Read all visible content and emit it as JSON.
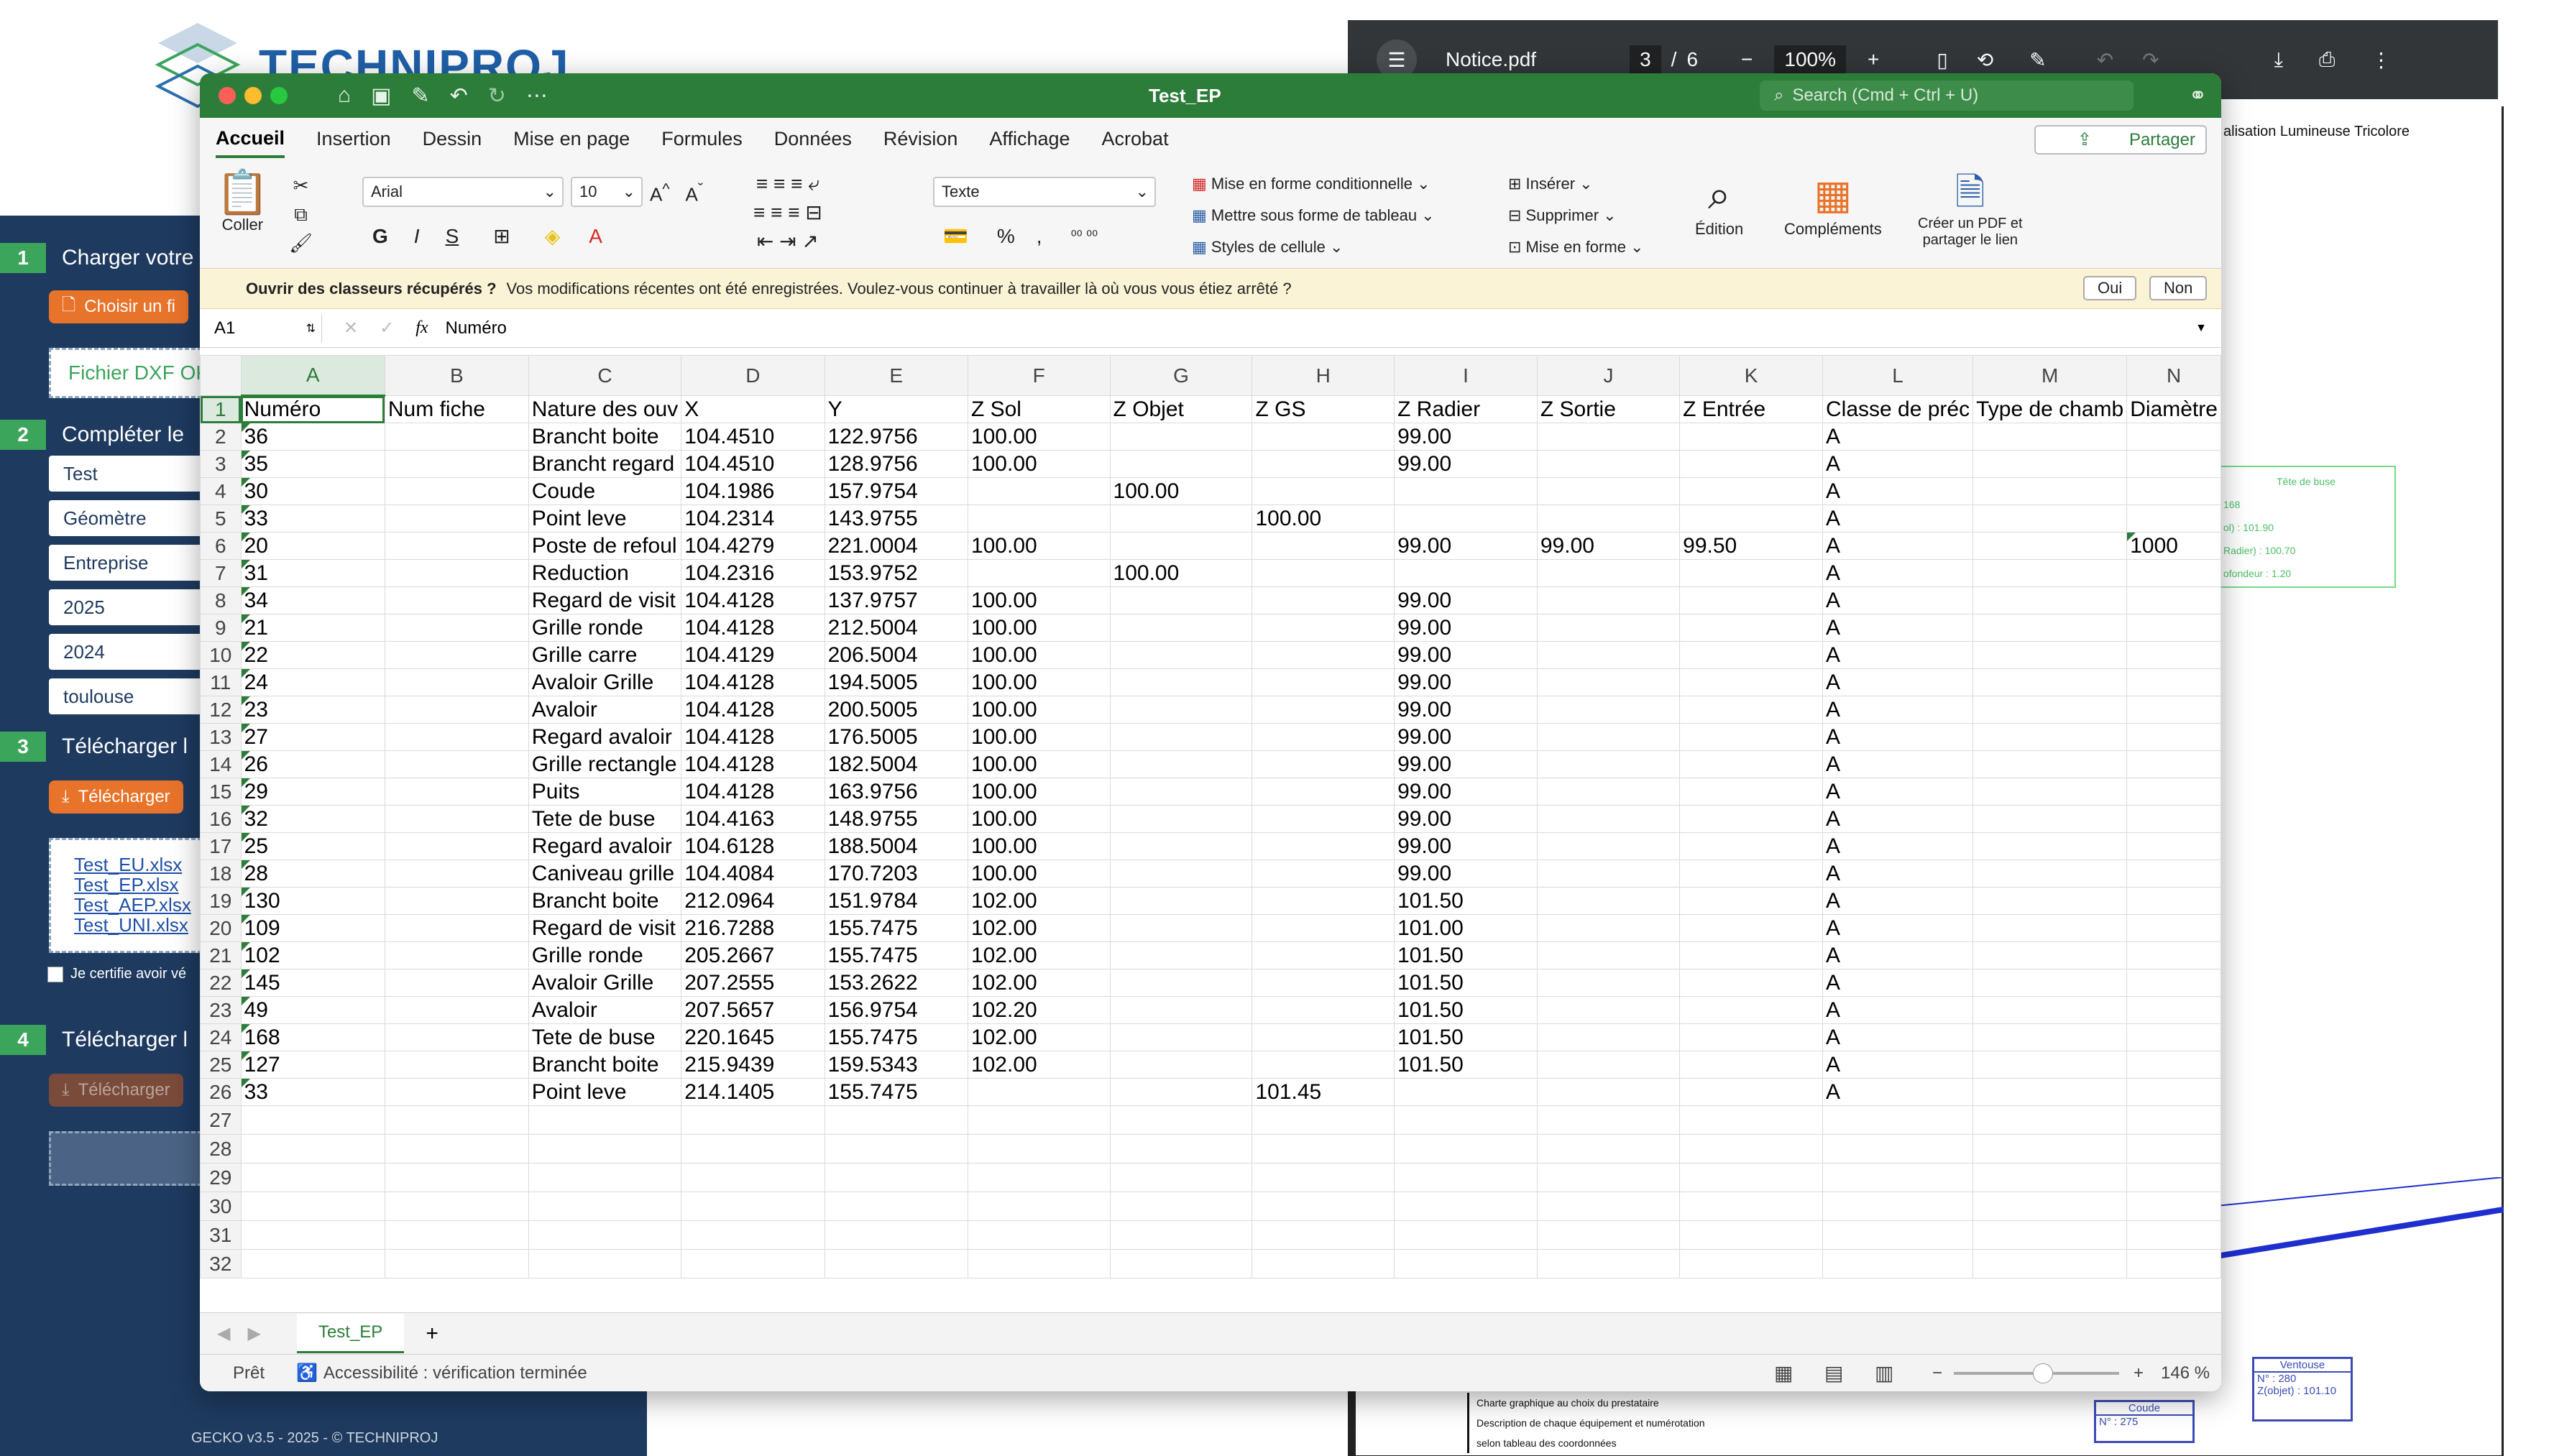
{
  "left_app": {
    "brand": "TECHNIPROJ",
    "steps": [
      {
        "num": "1",
        "label": "Charger votre",
        "button": "Choisir un fi",
        "status": "Fichier DXF OK"
      },
      {
        "num": "2",
        "label": "Compléter le",
        "fields": [
          "Test",
          "Géomètre",
          "Entreprise",
          "2025",
          "2024",
          "toulouse"
        ]
      },
      {
        "num": "3",
        "label": "Télécharger l",
        "button": "Télécharger",
        "files": [
          "Test_EU.xlsx",
          "Test_EP.xlsx",
          "Test_AEP.xlsx",
          "Test_UNI.xlsx"
        ],
        "certify": "Je certifie avoir vé"
      },
      {
        "num": "4",
        "label": "Télécharger l",
        "button": "Télécharger"
      }
    ],
    "footer": "GECKO v3.5 - 2025 - © TECHNIPROJ"
  },
  "pdf": {
    "title": "Notice.pdf",
    "page": "3",
    "total": "6",
    "zoom": "100%",
    "heading": "alisation Lumineuse Tricolore",
    "annotations": [
      "Tête de buse",
      "168",
      "ol) : 101.90",
      "Radier) : 100.70",
      "ofondeur : 1.20"
    ],
    "ventouse": {
      "title": "Ventouse",
      "n": "N° : 280",
      "z": "Z(objet) : 101.10"
    },
    "coude": {
      "title": "Coude",
      "n": "N° : 275"
    },
    "legend": [
      "Charte graphique au choix du prestataire",
      "Description de chaque équipement et numérotation",
      "selon tableau des coordonnées"
    ]
  },
  "excel": {
    "title": "Test_EP",
    "search": "Search (Cmd + Ctrl + U)",
    "tabs": [
      "Accueil",
      "Insertion",
      "Dessin",
      "Mise en page",
      "Formules",
      "Données",
      "Révision",
      "Affichage",
      "Acrobat"
    ],
    "share": "Partager",
    "ribbon": {
      "paste": "Coller",
      "font": "Arial",
      "size": "10",
      "format": "Texte",
      "cond": "Mise en forme conditionnelle",
      "table": "Mettre sous forme de tableau",
      "styles": "Styles de cellule",
      "insert": "Insérer",
      "delete": "Supprimer",
      "cellformat": "Mise en forme",
      "edit": "Édition",
      "addins": "Compléments",
      "pdf1": "Créer un PDF et",
      "pdf2": "partager le lien"
    },
    "notice": {
      "bold": "Ouvrir des classeurs récupérés ?",
      "text": "Vos modifications récentes ont été enregistrées. Voulez-vous continuer à travailler là où vous vous étiez arrêté ?",
      "yes": "Oui",
      "no": "Non"
    },
    "namebox": "A1",
    "formula": "Numéro",
    "columns": [
      "A",
      "B",
      "C",
      "D",
      "E",
      "F",
      "G",
      "H",
      "I",
      "J",
      "K",
      "L",
      "M",
      "N"
    ],
    "rows": [
      [
        "Numéro",
        "Num fiche",
        "Nature des ouv",
        "X",
        "Y",
        "Z Sol",
        "Z Objet",
        "Z GS",
        "Z Radier",
        "Z Sortie",
        "Z Entrée",
        "Classe de préc",
        "Type de chamb",
        "Diamètre"
      ],
      [
        "36",
        "",
        "Brancht boite",
        "104.4510",
        "122.9756",
        "100.00",
        "",
        "",
        "99.00",
        "",
        "",
        "A",
        "",
        ""
      ],
      [
        "35",
        "",
        "Brancht regard",
        "104.4510",
        "128.9756",
        "100.00",
        "",
        "",
        "99.00",
        "",
        "",
        "A",
        "",
        ""
      ],
      [
        "30",
        "",
        "Coude",
        "104.1986",
        "157.9754",
        "",
        "100.00",
        "",
        "",
        "",
        "",
        "A",
        "",
        ""
      ],
      [
        "33",
        "",
        "Point leve",
        "104.2314",
        "143.9755",
        "",
        "",
        "100.00",
        "",
        "",
        "",
        "A",
        "",
        ""
      ],
      [
        "20",
        "",
        "Poste de refoul",
        "104.4279",
        "221.0004",
        "100.00",
        "",
        "",
        "99.00",
        "99.00",
        "99.50",
        "A",
        "",
        "1000"
      ],
      [
        "31",
        "",
        "Reduction",
        "104.2316",
        "153.9752",
        "",
        "100.00",
        "",
        "",
        "",
        "",
        "A",
        "",
        ""
      ],
      [
        "34",
        "",
        "Regard de visit",
        "104.4128",
        "137.9757",
        "100.00",
        "",
        "",
        "99.00",
        "",
        "",
        "A",
        "",
        ""
      ],
      [
        "21",
        "",
        "Grille ronde",
        "104.4128",
        "212.5004",
        "100.00",
        "",
        "",
        "99.00",
        "",
        "",
        "A",
        "",
        ""
      ],
      [
        "22",
        "",
        "Grille carre",
        "104.4129",
        "206.5004",
        "100.00",
        "",
        "",
        "99.00",
        "",
        "",
        "A",
        "",
        ""
      ],
      [
        "24",
        "",
        "Avaloir Grille",
        "104.4128",
        "194.5005",
        "100.00",
        "",
        "",
        "99.00",
        "",
        "",
        "A",
        "",
        ""
      ],
      [
        "23",
        "",
        "Avaloir",
        "104.4128",
        "200.5005",
        "100.00",
        "",
        "",
        "99.00",
        "",
        "",
        "A",
        "",
        ""
      ],
      [
        "27",
        "",
        "Regard avaloir",
        "104.4128",
        "176.5005",
        "100.00",
        "",
        "",
        "99.00",
        "",
        "",
        "A",
        "",
        ""
      ],
      [
        "26",
        "",
        "Grille rectangle",
        "104.4128",
        "182.5004",
        "100.00",
        "",
        "",
        "99.00",
        "",
        "",
        "A",
        "",
        ""
      ],
      [
        "29",
        "",
        "Puits",
        "104.4128",
        "163.9756",
        "100.00",
        "",
        "",
        "99.00",
        "",
        "",
        "A",
        "",
        ""
      ],
      [
        "32",
        "",
        "Tete de buse",
        "104.4163",
        "148.9755",
        "100.00",
        "",
        "",
        "99.00",
        "",
        "",
        "A",
        "",
        ""
      ],
      [
        "25",
        "",
        "Regard avaloir",
        "104.6128",
        "188.5004",
        "100.00",
        "",
        "",
        "99.00",
        "",
        "",
        "A",
        "",
        ""
      ],
      [
        "28",
        "",
        "Caniveau grille",
        "104.4084",
        "170.7203",
        "100.00",
        "",
        "",
        "99.00",
        "",
        "",
        "A",
        "",
        ""
      ],
      [
        "130",
        "",
        "Brancht boite",
        "212.0964",
        "151.9784",
        "102.00",
        "",
        "",
        "101.50",
        "",
        "",
        "A",
        "",
        ""
      ],
      [
        "109",
        "",
        "Regard de visit",
        "216.7288",
        "155.7475",
        "102.00",
        "",
        "",
        "101.00",
        "",
        "",
        "A",
        "",
        ""
      ],
      [
        "102",
        "",
        "Grille ronde",
        "205.2667",
        "155.7475",
        "102.00",
        "",
        "",
        "101.50",
        "",
        "",
        "A",
        "",
        ""
      ],
      [
        "145",
        "",
        "Avaloir Grille",
        "207.2555",
        "153.2622",
        "102.00",
        "",
        "",
        "101.50",
        "",
        "",
        "A",
        "",
        ""
      ],
      [
        "49",
        "",
        "Avaloir",
        "207.5657",
        "156.9754",
        "102.20",
        "",
        "",
        "101.50",
        "",
        "",
        "A",
        "",
        ""
      ],
      [
        "168",
        "",
        "Tete de buse",
        "220.1645",
        "155.7475",
        "102.00",
        "",
        "",
        "101.50",
        "",
        "",
        "A",
        "",
        ""
      ],
      [
        "127",
        "",
        "Brancht boite",
        "215.9439",
        "159.5343",
        "102.00",
        "",
        "",
        "101.50",
        "",
        "",
        "A",
        "",
        ""
      ],
      [
        "33",
        "",
        "Point leve",
        "214.1405",
        "155.7475",
        "",
        "",
        "101.45",
        "",
        "",
        "",
        "A",
        "",
        ""
      ],
      [
        "",
        "",
        "",
        "",
        "",
        "",
        "",
        "",
        "",
        "",
        "",
        "",
        "",
        ""
      ],
      [
        "",
        "",
        "",
        "",
        "",
        "",
        "",
        "",
        "",
        "",
        "",
        "",
        "",
        ""
      ],
      [
        "",
        "",
        "",
        "",
        "",
        "",
        "",
        "",
        "",
        "",
        "",
        "",
        "",
        ""
      ],
      [
        "",
        "",
        "",
        "",
        "",
        "",
        "",
        "",
        "",
        "",
        "",
        "",
        "",
        ""
      ],
      [
        "",
        "",
        "",
        "",
        "",
        "",
        "",
        "",
        "",
        "",
        "",
        "",
        "",
        ""
      ],
      [
        "",
        "",
        "",
        "",
        "",
        "",
        "",
        "",
        "",
        "",
        "",
        "",
        "",
        ""
      ]
    ],
    "sheet": "Test_EP",
    "status": {
      "ready": "Prêt",
      "access": "Accessibilité : vérification terminée",
      "zoom": "146 %"
    }
  }
}
